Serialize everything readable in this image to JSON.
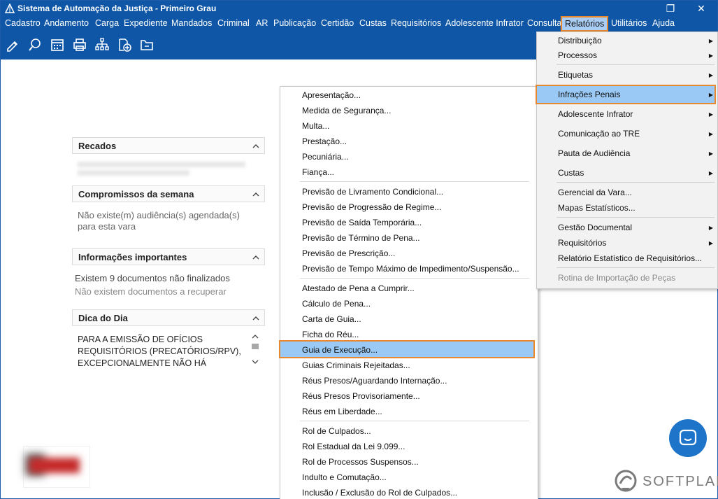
{
  "window": {
    "title": "Sistema de Automação da Justiça - Primeiro Grau",
    "restore_glyph": "❐",
    "close_glyph": "✕"
  },
  "menubar": [
    "Cadastro",
    "Andamento",
    "Carga",
    "Expediente",
    "Mandados",
    "Criminal",
    "AR",
    "Publicação",
    "Certidão",
    "Custas",
    "Requisitórios",
    "Adolescente Infrator",
    "Consulta",
    "Relatórios",
    "Utilitários",
    "Ajuda"
  ],
  "toolbar_icons": [
    "edit-icon",
    "search-icon",
    "calendar-icon",
    "printer-icon",
    "tree-icon",
    "add-doc-icon",
    "folder-icon"
  ],
  "panels": {
    "recados": {
      "title": "Recados"
    },
    "compromissos": {
      "title": "Compromissos da semana",
      "line1": "Não existe(m) audiência(s) agendada(s)",
      "line2": "para esta vara"
    },
    "informacoes": {
      "title": "Informações importantes",
      "line1": "Existem 9 documentos não finalizados",
      "line2": "Não existem documentos a recuperar"
    },
    "dica": {
      "title": "Dica do Dia",
      "line1": "PARA A EMISSÃO DE OFÍCIOS",
      "line2": "REQUISITÓRIOS (PRECATÓRIOS/RPV),",
      "line3": "EXCEPCIONALMENTE NÃO HÁ"
    }
  },
  "relatorios_menu": [
    {
      "label": "Distribuição",
      "arrow": true
    },
    {
      "label": "Processos",
      "arrow": true
    },
    {
      "label": "Etiquetas",
      "arrow": true
    },
    {
      "label": "Infrações Penais",
      "arrow": true,
      "highlight": true
    },
    {
      "label": "Adolescente Infrator",
      "arrow": true
    },
    {
      "label": "Comunicação ao TRE",
      "arrow": true
    },
    {
      "label": "Pauta de Audiência",
      "arrow": true
    },
    {
      "label": "Custas",
      "arrow": true
    },
    {
      "label": "Gerencial da Vara...",
      "arrow": false
    },
    {
      "label": "Mapas Estatísticos...",
      "arrow": false
    },
    {
      "label": "Gestão Documental",
      "arrow": true
    },
    {
      "label": "Requisitórios",
      "arrow": true
    },
    {
      "label": "Relatório Estatístico de Requisitórios...",
      "arrow": false
    },
    {
      "label": "Rotina de Importação de Peças",
      "arrow": false,
      "disabled": true
    }
  ],
  "arrow_glyph": "▶",
  "infracoes_submenu": [
    "Apresentação...",
    "Medida de Segurança...",
    "Multa...",
    "Prestação...",
    "Pecuniária...",
    "Fiança...",
    "Previsão de Livramento Condicional...",
    "Previsão de Progressão de Regime...",
    "Previsão de Saída Temporária...",
    "Previsão de Término de Pena...",
    "Previsão de Prescrição...",
    "Previsão de Tempo Máximo de Impedimento/Suspensão...",
    "Atestado de Pena a Cumprir...",
    "Cálculo de Pena...",
    "Carta de Guia...",
    "Ficha do Réu...",
    "Guia de Execução...",
    "Guias Criminais Rejeitadas...",
    "Réus Presos/Aguardando Internação...",
    "Réus Presos Provisoriamente...",
    "Réus em Liberdade...",
    "Rol de Culpados...",
    "Rol Estadual da Lei 9.099...",
    "Rol de Processos Suspensos...",
    "Indulto e Comutação...",
    "Inclusão / Exclusão do Rol de Culpados..."
  ],
  "brand": {
    "name": "SOFTPLAN"
  },
  "colors": {
    "accent": "#0f57a6",
    "highlight": "#99c9f4",
    "focus_border": "#e8892f"
  }
}
